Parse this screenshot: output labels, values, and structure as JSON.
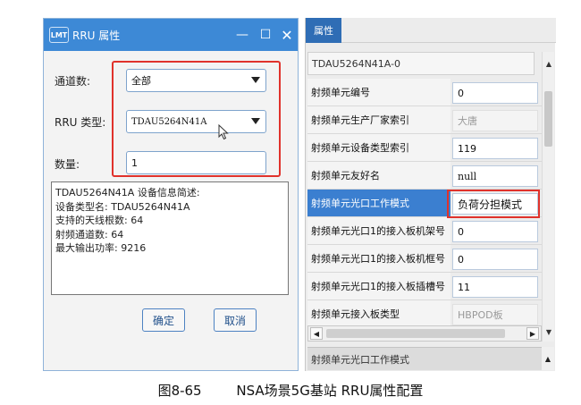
{
  "dialog": {
    "logo": "LMT",
    "title": "RRU 属性",
    "min_glyph": "—",
    "max_glyph": "☐",
    "close_glyph": "✕",
    "channel_label": "通道数:",
    "channel_value": "全部",
    "rru_type_label": "RRU 类型:",
    "rru_type_value": "TDAU5264N41A",
    "quantity_label": "数量:",
    "quantity_value": "1",
    "info_lines": [
      "TDAU5264N41A 设备信息简述:",
      "设备类型名: TDAU5264N41A",
      "支持的天线根数: 64",
      "射频通道数: 64",
      "最大输出功率: 9216"
    ],
    "ok_label": "确定",
    "cancel_label": "取消"
  },
  "panel": {
    "tab_label": "属性",
    "header": "TDAU5264N41A-0",
    "rows": [
      {
        "name": "射频单元编号",
        "value": "0"
      },
      {
        "name": "射频单元生产厂家索引",
        "value": "大唐"
      },
      {
        "name": "射频单元设备类型索引",
        "value": "119"
      },
      {
        "name": "射频单元友好名",
        "value": "null"
      },
      {
        "name": "射频单元光口工作模式",
        "value": "负荷分担模式"
      },
      {
        "name": "射频单元光口1的接入板机架号",
        "value": "0"
      },
      {
        "name": "射频单元光口1的接入板机框号",
        "value": "0"
      },
      {
        "name": "射频单元光口1的接入板插槽号",
        "value": "11"
      },
      {
        "name": "射频单元接入板类型",
        "value": "HBPOD板"
      }
    ],
    "description": "射频单元光口工作模式"
  },
  "caption": {
    "figure_number": "图8-65",
    "text": "NSA场景5G基站 RRU属性配置"
  }
}
